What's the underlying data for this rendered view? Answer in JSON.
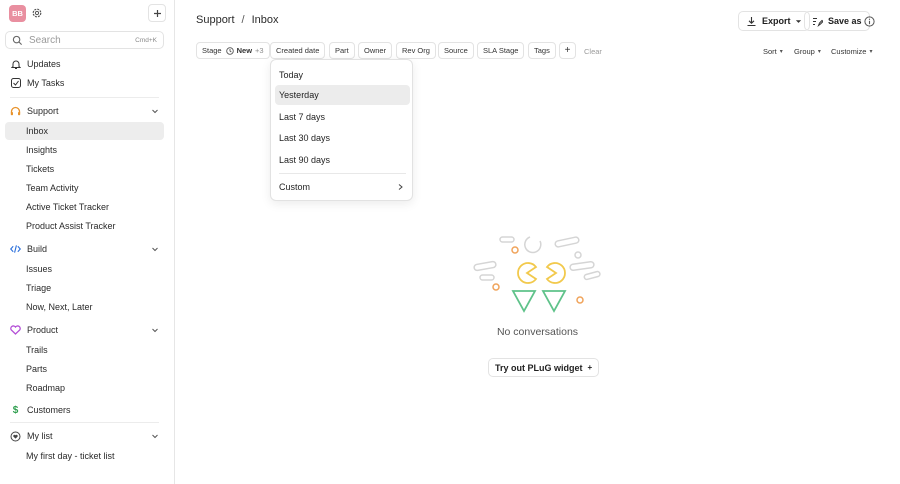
{
  "sidebar": {
    "avatar_initials": "BB",
    "search": {
      "placeholder": "Search",
      "shortcut": "Cmd+K"
    },
    "top_items": [
      {
        "label": "Updates",
        "icon": "bell-icon"
      },
      {
        "label": "My Tasks",
        "icon": "check-square-icon"
      }
    ],
    "sections": {
      "support": {
        "label": "Support",
        "icon": "headset-icon",
        "color": "#e8932c",
        "items": [
          "Inbox",
          "Insights",
          "Tickets",
          "Team Activity",
          "Active Ticket Tracker",
          "Product Assist Tracker"
        ]
      },
      "build": {
        "label": "Build",
        "icon": "code-icon",
        "color": "#2a6fdb",
        "items": [
          "Issues",
          "Triage",
          "Now, Next, Later"
        ]
      },
      "product": {
        "label": "Product",
        "icon": "heart-icon",
        "color": "#b34fd6",
        "items": [
          "Trails",
          "Parts",
          "Roadmap"
        ]
      },
      "customers": {
        "label": "Customers",
        "icon": "dollar-icon",
        "color": "#2e9e4e"
      },
      "mylist": {
        "label": "My list",
        "icon": "heart-outline-icon",
        "items": [
          "My first day - ticket list"
        ]
      }
    },
    "selected_item": "Inbox"
  },
  "header": {
    "breadcrumb": [
      "Support",
      "Inbox"
    ],
    "separator": "/",
    "export_label": "Export",
    "save_as_label": "Save as"
  },
  "filters": {
    "stage": {
      "label": "Stage",
      "value": "New",
      "extra": "+3"
    },
    "chips": [
      "Created date",
      "Part",
      "Owner",
      "Rev Org",
      "Source",
      "SLA Stage",
      "Tags"
    ],
    "add": "+",
    "clear": "Clear",
    "right": [
      "Sort",
      "Group",
      "Customize"
    ]
  },
  "date_dropdown": {
    "options": [
      "Today",
      "Yesterday",
      "Last 7 days",
      "Last 30 days",
      "Last 90 days"
    ],
    "highlighted": "Yesterday",
    "custom_label": "Custom"
  },
  "empty_state": {
    "message": "No conversations",
    "button_label": "Try out PLuG widget",
    "button_suffix": "+"
  },
  "colors": {
    "accent_yellow": "#f2c94c",
    "accent_green": "#5fc28a",
    "accent_orange": "#f0a35a",
    "grey": "#d5d5d5"
  }
}
